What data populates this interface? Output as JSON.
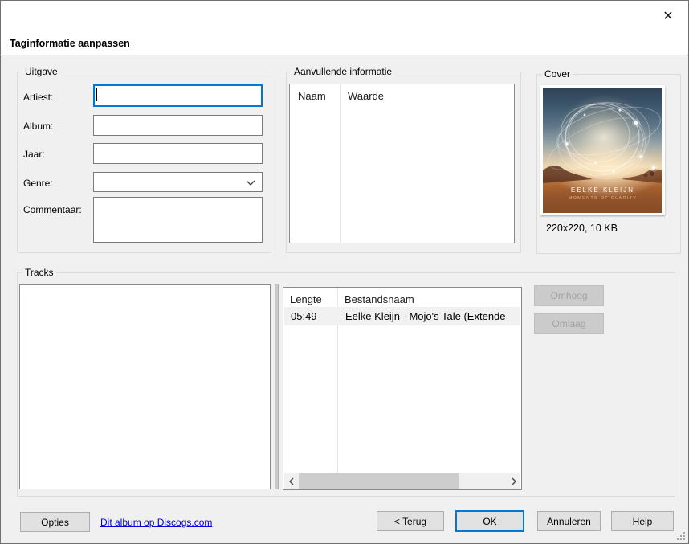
{
  "window": {
    "title": "Taginformatie aanpassen",
    "close_glyph": "✕"
  },
  "groups": {
    "uitgave": {
      "label": "Uitgave",
      "artiest_label": "Artiest:",
      "artiest_value": "",
      "album_label": "Album:",
      "album_value": "",
      "jaar_label": "Jaar:",
      "jaar_value": "",
      "genre_label": "Genre:",
      "genre_value": "",
      "commentaar_label": "Commentaar:",
      "commentaar_value": ""
    },
    "aanvullende": {
      "label": "Aanvullende informatie",
      "columns": [
        "Naam",
        "Waarde"
      ],
      "rows": []
    },
    "cover": {
      "label": "Cover",
      "artist_text": "EELKE KLEIJN",
      "album_text": "MOMENTS OF CLARITY",
      "info": "220x220, 10 KB"
    },
    "tracks": {
      "label": "Tracks",
      "columns": [
        "Lengte",
        "Bestandsnaam"
      ],
      "rows": [
        {
          "lengte": "05:49",
          "bestandsnaam": "Eelke Kleijn - Mojo's Tale (Extende",
          "selected": true
        }
      ],
      "omhoog_label": "Omhoog",
      "omlaag_label": "Omlaag"
    }
  },
  "footer": {
    "opties_label": "Opties",
    "discogs_link": "Dit album op Discogs.com",
    "terug_label": "< Terug",
    "ok_label": "OK",
    "annuleren_label": "Annuleren",
    "help_label": "Help"
  },
  "colors": {
    "accent": "#0078d7",
    "link": "#0000e0",
    "body_bg": "#f0f0f0",
    "header_bg": "#ffffff",
    "disabled_button_bg": "#cbcbcb",
    "selected_row_bg": "#f1f1f1"
  }
}
